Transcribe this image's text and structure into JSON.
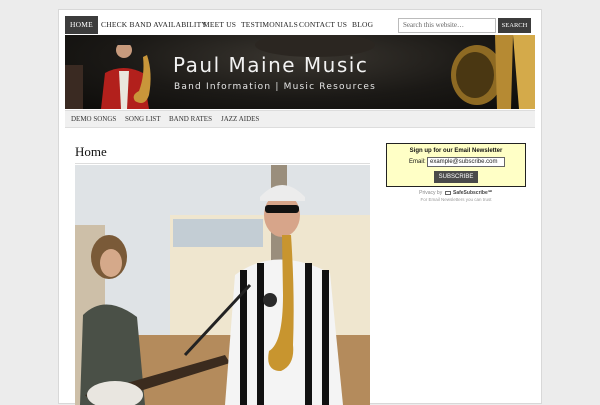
{
  "nav": {
    "items": [
      "HOME",
      "CHECK BAND AVAILABILITY",
      "MEET US",
      "TESTIMONIALS",
      "CONTACT US",
      "BLOG"
    ],
    "search_placeholder": "Search this website…",
    "search_button": "SEARCH"
  },
  "banner": {
    "title": "Paul Maine Music",
    "subtitle": "Band Information | Music Resources"
  },
  "subnav": {
    "items": [
      "DEMO SONGS",
      "SONG LIST",
      "BAND RATES",
      "JAZZ AIDES"
    ]
  },
  "main": {
    "page_title": "Home"
  },
  "newsletter": {
    "heading": "Sign up for our Email Newsletter",
    "email_label": "Email:",
    "email_value": "example@subscribe.com",
    "subscribe_button": "SUBSCRIBE",
    "privacy_prefix": "Privacy by",
    "privacy_brand": "SafeSubscribe℠",
    "note": "For Email Newsletters you can trust"
  },
  "colors": {
    "nav_active": "#3c3c3c",
    "banner_bg": "#141210",
    "newsletter_bg": "#ffffc6"
  }
}
